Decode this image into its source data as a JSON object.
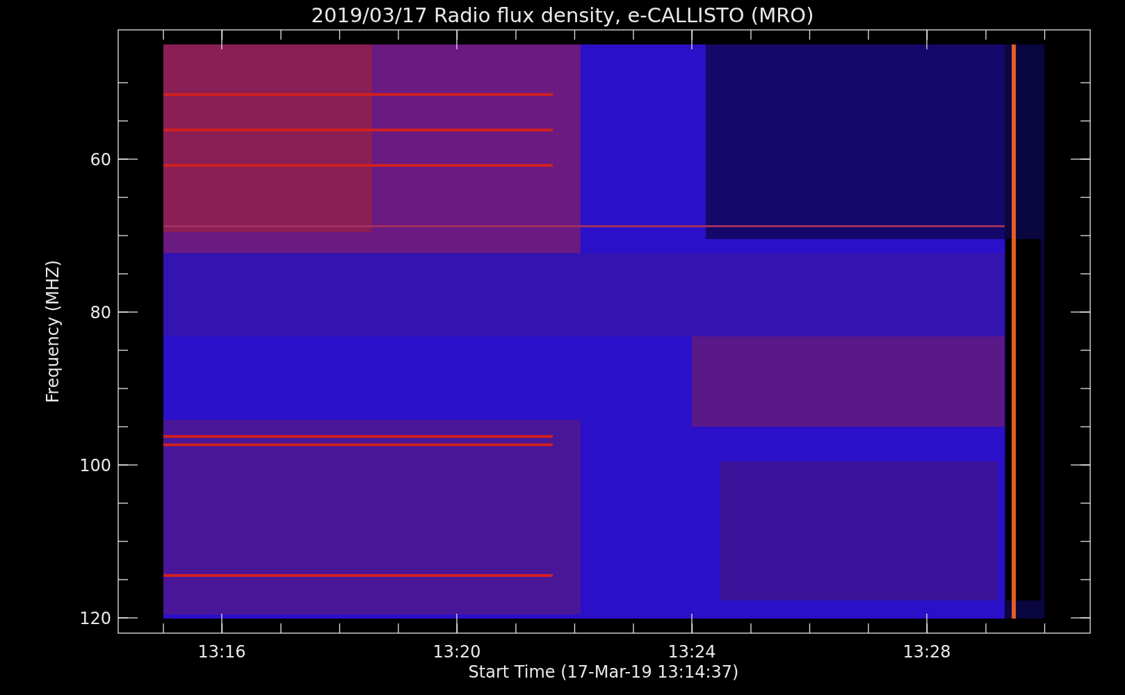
{
  "title": "2019/03/17  Radio flux density, e-CALLISTO (MRO)",
  "y_axis": {
    "label": "Frequency (MHZ)",
    "ticks": [
      "60",
      "80",
      "100",
      "120"
    ]
  },
  "x_axis": {
    "label": "Start Time (17-Mar-19 13:14:37)",
    "ticks": [
      "13:16",
      "13:20",
      "13:24",
      "13:28"
    ]
  }
}
